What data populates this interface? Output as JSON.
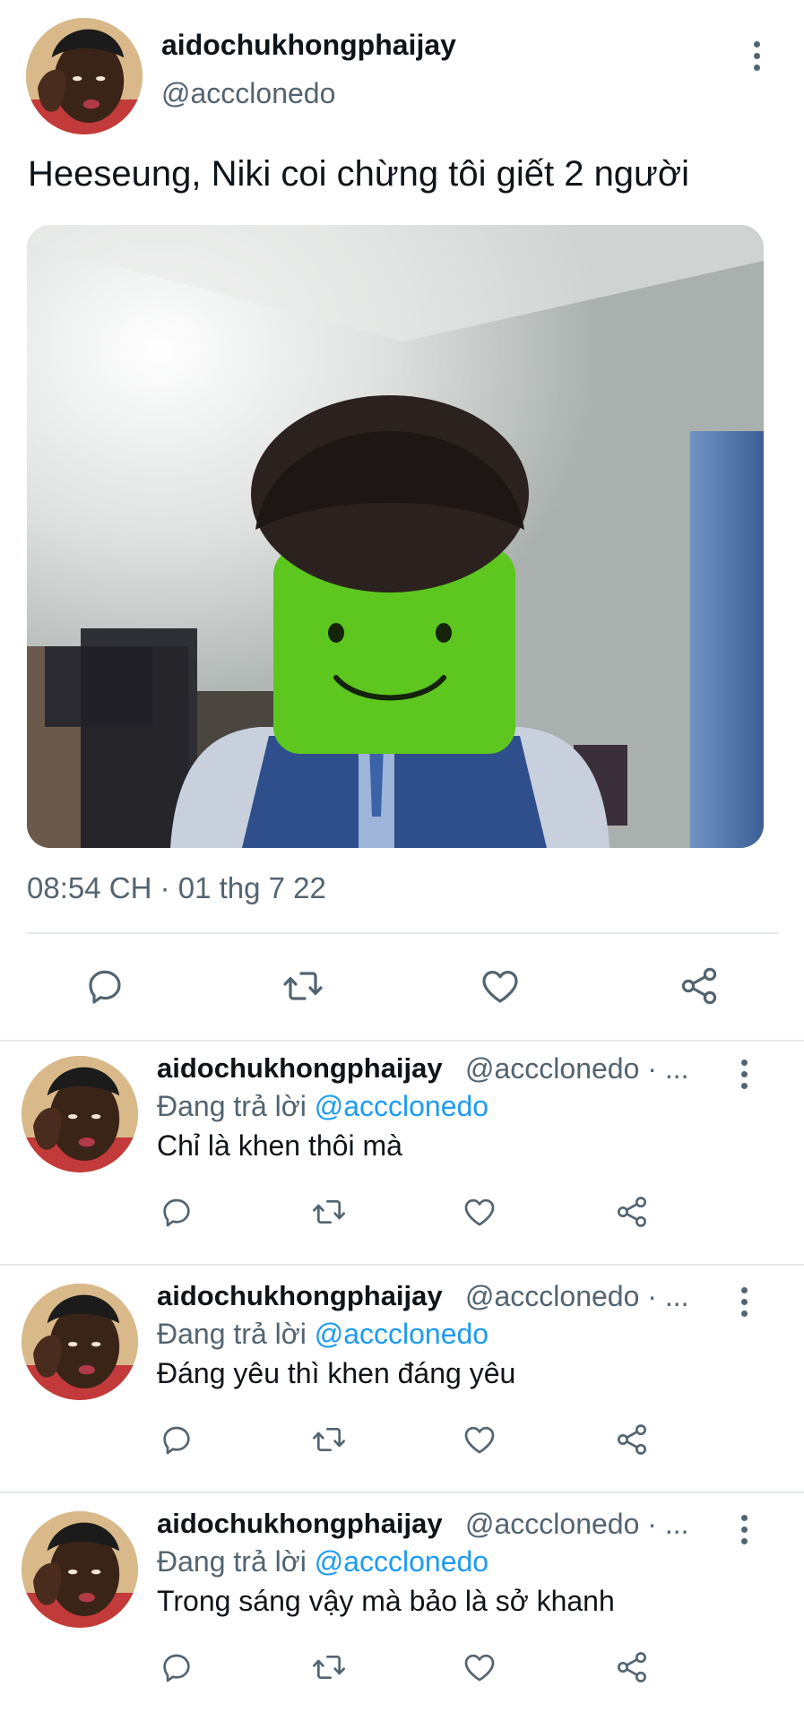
{
  "main_tweet": {
    "display_name": "aidochukhongphaijay",
    "handle": "@accclonedo",
    "text": "Heeseung, Niki coi chừng tôi giết 2 người",
    "timestamp": "08:54 CH · 01 thg 7 22",
    "actions": [
      "reply-icon",
      "retweet-icon",
      "like-icon",
      "share-icon"
    ]
  },
  "replies": [
    {
      "display_name": "aidochukhongphaijay",
      "handle": "@accclonedo · ...",
      "replying_prefix": "Đang trả lời ",
      "replying_to": "@accclonedo",
      "text": "Chỉ là khen thôi mà"
    },
    {
      "display_name": "aidochukhongphaijay",
      "handle": "@accclonedo · ...",
      "replying_prefix": "Đang trả lời ",
      "replying_to": "@accclonedo",
      "text": "Đáng yêu thì khen đáng yêu"
    },
    {
      "display_name": "aidochukhongphaijay",
      "handle": "@accclonedo · ...",
      "replying_prefix": "Đang trả lời ",
      "replying_to": "@accclonedo",
      "text": "Trong sáng vậy mà bảo là sở khanh"
    }
  ],
  "colors": {
    "text_primary": "#0f1419",
    "text_secondary": "#536471",
    "link": "#1d9bf0",
    "divider": "#e6e9eb",
    "icon": "#536471"
  }
}
